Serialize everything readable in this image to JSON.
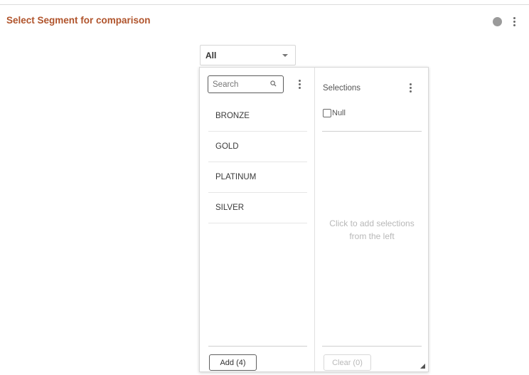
{
  "header": {
    "title": "Select Segment for comparison"
  },
  "select": {
    "value": "All"
  },
  "search": {
    "placeholder": "Search"
  },
  "list": {
    "items": [
      "BRONZE",
      "GOLD",
      "PLATINUM",
      "SILVER"
    ]
  },
  "selections": {
    "title": "Selections",
    "null_label": "Null",
    "empty_message": "Click to add selections from the left"
  },
  "buttons": {
    "add_label": "Add (4)",
    "clear_label": "Clear (0)"
  },
  "colors": {
    "title": "#b0542c",
    "status_dot": "#9a9a9a"
  }
}
